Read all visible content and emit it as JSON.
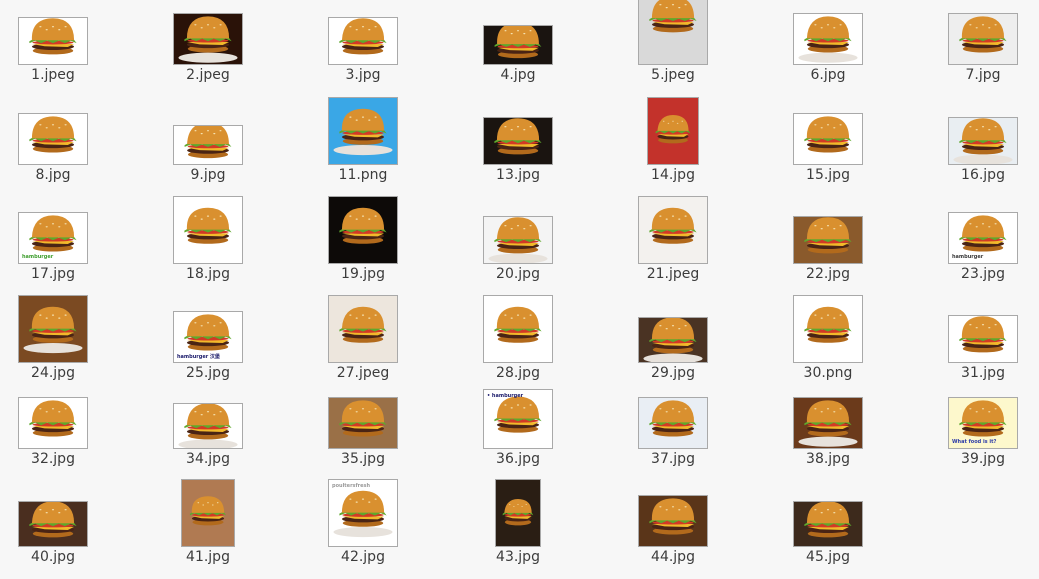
{
  "files": [
    {
      "name": "1.jpeg",
      "bg": "#ffffff"
    },
    {
      "name": "2.jpeg",
      "bg": "#2a1208"
    },
    {
      "name": "3.jpg",
      "bg": "#ffffff"
    },
    {
      "name": "4.jpg",
      "bg": "#1a1410"
    },
    {
      "name": "5.jpeg",
      "bg": "#d9d9d9"
    },
    {
      "name": "6.jpg",
      "bg": "#ffffff"
    },
    {
      "name": "7.jpg",
      "bg": "#eeeeee"
    },
    {
      "name": "8.jpg",
      "bg": "#ffffff"
    },
    {
      "name": "9.jpg",
      "bg": "#ffffff"
    },
    {
      "name": "11.png",
      "bg": "#3aa7e6"
    },
    {
      "name": "13.jpg",
      "bg": "#1a1410"
    },
    {
      "name": "14.jpg",
      "bg": "#c3322b"
    },
    {
      "name": "15.jpg",
      "bg": "#ffffff"
    },
    {
      "name": "16.jpg",
      "bg": "#e9eef2"
    },
    {
      "name": "17.jpg",
      "bg": "#ffffff",
      "caption": "hamburger",
      "capColor": "#3f9e2e"
    },
    {
      "name": "18.jpg",
      "bg": "#ffffff"
    },
    {
      "name": "19.jpg",
      "bg": "#0d0a08"
    },
    {
      "name": "20.jpg",
      "bg": "#f4f4f4"
    },
    {
      "name": "21.jpeg",
      "bg": "#f3f1ee"
    },
    {
      "name": "22.jpg",
      "bg": "#8a5a2c"
    },
    {
      "name": "23.jpg",
      "bg": "#ffffff",
      "caption": "hamburger",
      "capColor": "#3a3a3a"
    },
    {
      "name": "24.jpg",
      "bg": "#7b4a22"
    },
    {
      "name": "25.jpg",
      "bg": "#ffffff",
      "caption": "hamburger 汉堡",
      "capColor": "#1b1b6b"
    },
    {
      "name": "27.jpeg",
      "bg": "#ede6dd"
    },
    {
      "name": "28.jpg",
      "bg": "#ffffff"
    },
    {
      "name": "29.jpg",
      "bg": "#4a3323"
    },
    {
      "name": "30.png",
      "bg": "#ffffff"
    },
    {
      "name": "31.jpg",
      "bg": "#ffffff"
    },
    {
      "name": "32.jpg",
      "bg": "#ffffff"
    },
    {
      "name": "34.jpg",
      "bg": "#ffffff"
    },
    {
      "name": "35.jpg",
      "bg": "#9a7047"
    },
    {
      "name": "36.jpg",
      "bg": "#ffffff",
      "caption": "• hamburger",
      "capColor": "#1b1b6b"
    },
    {
      "name": "37.jpg",
      "bg": "#e9eef4"
    },
    {
      "name": "38.jpg",
      "bg": "#6b3a1b"
    },
    {
      "name": "39.jpg",
      "bg": "#fdf8cc",
      "caption": "What food is it?",
      "capColor": "#2b3aa8"
    },
    {
      "name": "40.jpg",
      "bg": "#4a2e1f"
    },
    {
      "name": "41.jpg",
      "bg": "#b07a52"
    },
    {
      "name": "42.jpg",
      "bg": "#ffffff",
      "caption": "poultersfresh",
      "capColor": "#9a9a9a"
    },
    {
      "name": "43.jpg",
      "bg": "#2a1e14"
    },
    {
      "name": "44.jpg",
      "bg": "#5a3519"
    },
    {
      "name": "45.jpg",
      "bg": "#3d2a1c"
    }
  ],
  "colors": {
    "bun": "#d9902f",
    "bunDark": "#b26a1c",
    "lettuce": "#5fa82c",
    "tomato": "#d13a26",
    "cheese": "#f2b92b",
    "patty": "#4a2414",
    "labelText": "#3c3c3c",
    "background": "#f7f7f7"
  }
}
